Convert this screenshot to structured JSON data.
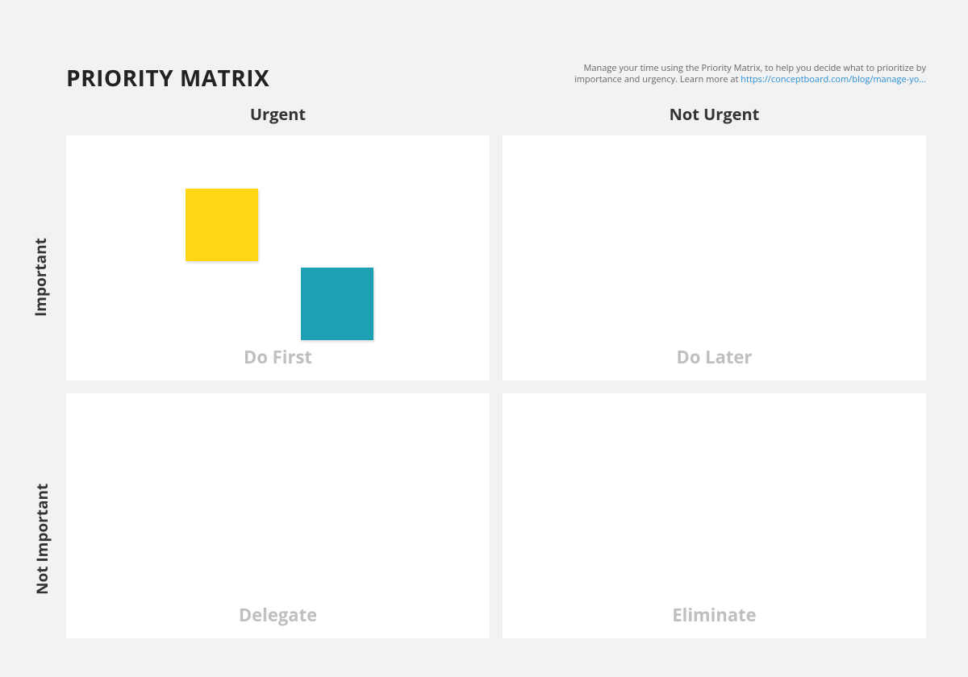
{
  "header": {
    "title": "PRIORITY MATRIX",
    "description_text": "Manage your time using the Priority Matrix, to help you decide what to prioritize by importance and urgency. Learn more at ",
    "link_text": "https://conceptboard.com/blog/manage-yo..."
  },
  "columns": [
    "Urgent",
    "Not Urgent"
  ],
  "rows": [
    "Important",
    "Not Important"
  ],
  "quadrants": {
    "top_left": "Do First",
    "top_right": "Do Later",
    "bottom_left": "Delegate",
    "bottom_right": "Eliminate"
  },
  "stickies": {
    "yellow": {
      "color": "#ffd614"
    },
    "teal": {
      "color": "#1ea1b5"
    }
  }
}
